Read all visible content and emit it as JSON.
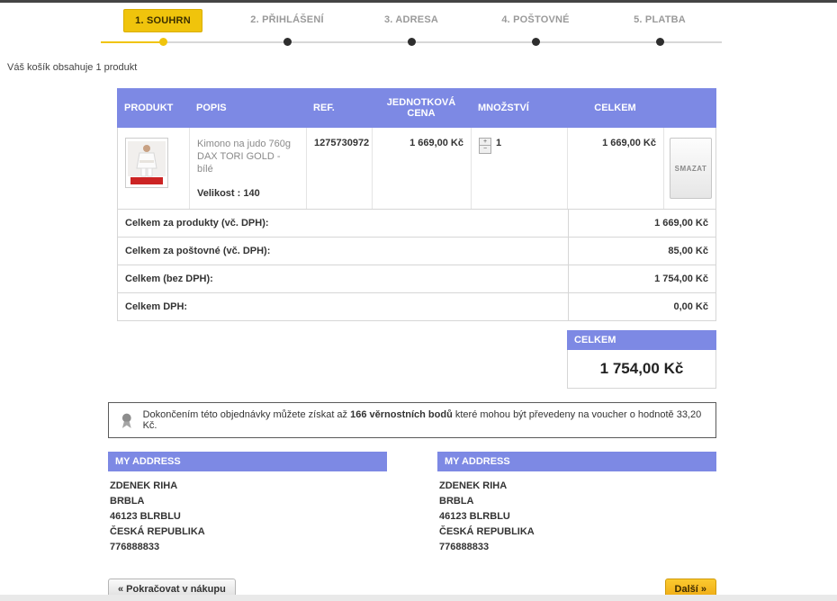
{
  "page": {
    "cart_text": "Váš košík obsahuje 1 produkt"
  },
  "stepper": {
    "steps": [
      {
        "label": "1. SOUHRN"
      },
      {
        "label": "2. PŘIHLÁŠENÍ"
      },
      {
        "label": "3. ADRESA"
      },
      {
        "label": "4. POŠTOVNÉ"
      },
      {
        "label": "5. PLATBA"
      }
    ]
  },
  "table": {
    "headers": {
      "product": "PRODUKT",
      "description": "POPIS",
      "ref": "REF.",
      "unit_price": "JEDNOTKOVÁ CENA",
      "quantity": "MNOŽSTVÍ",
      "total": "CELKEM"
    },
    "product": {
      "name": "Kimono na judo 760g DAX TORI GOLD - bílé",
      "size": "Velikost : 140",
      "ref": "1275730972",
      "unit_price": "1 669,00 Kč",
      "quantity": "1",
      "total": "1 669,00 Kč",
      "delete_label": "SMAZAT"
    },
    "totals": [
      {
        "label": "Celkem za produkty (vč. DPH):",
        "value": "1 669,00 Kč"
      },
      {
        "label": "Celkem za poštovné (vč. DPH):",
        "value": "85,00 Kč"
      },
      {
        "label": "Celkem (bez DPH):",
        "value": "1 754,00 Kč"
      },
      {
        "label": "Celkem DPH:",
        "value": "0,00 Kč"
      }
    ],
    "grand_total": {
      "label": "CELKEM",
      "value": "1 754,00 Kč"
    }
  },
  "loyalty": {
    "prefix": "Dokončením této objednávky můžete získat až ",
    "points": "166 věrnostních bodů",
    "suffix": " které mohou být převedeny na voucher o hodnotě 33,20 Kč."
  },
  "addresses": [
    {
      "title": "MY ADDRESS",
      "lines": [
        "ZDENEK RIHA",
        "BRBLA",
        "46123 BLRBLU",
        "ČESKÁ REPUBLIKA",
        "776888833"
      ]
    },
    {
      "title": "MY ADDRESS",
      "lines": [
        "ZDENEK RIHA",
        "BRBLA",
        "46123 BLRBLU",
        "ČESKÁ REPUBLIKA",
        "776888833"
      ]
    }
  ],
  "buttons": {
    "back": "« Pokračovat v nákupu",
    "next": "Další »"
  },
  "colors": {
    "header_blue": "#7d89e4",
    "accent_yellow": "#f0c40c"
  }
}
